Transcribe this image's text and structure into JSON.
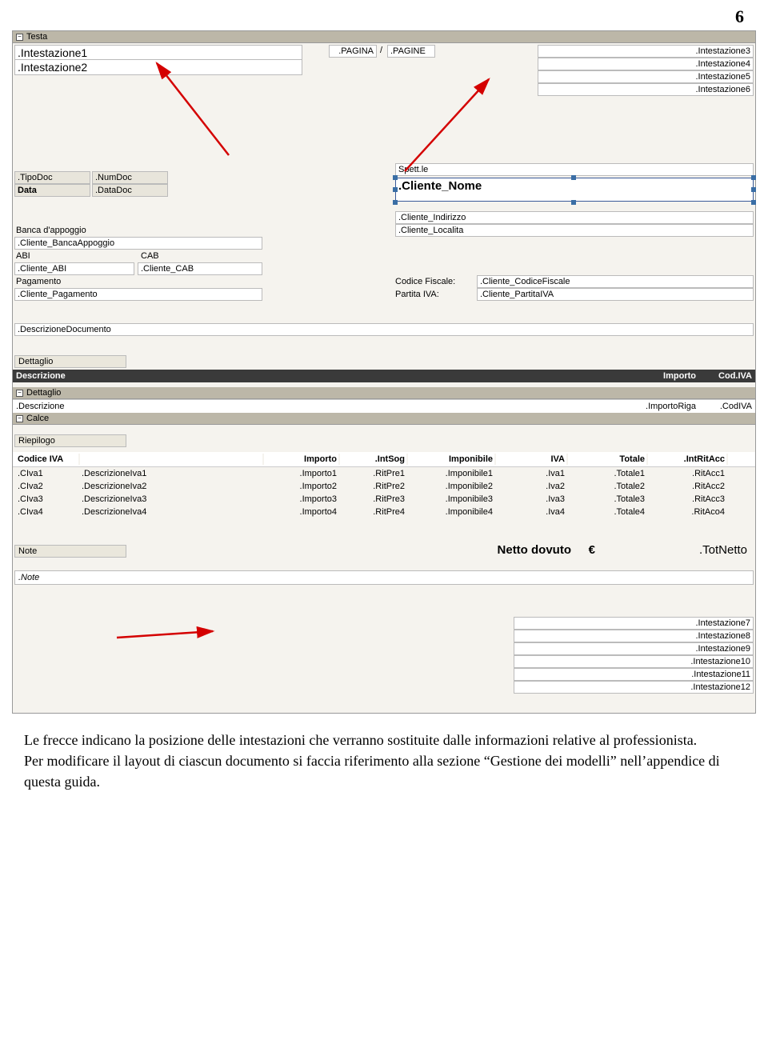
{
  "page_number": "6",
  "bands": {
    "testa": "Testa",
    "dettaglio": "Dettaglio",
    "calce": "Calce"
  },
  "header": {
    "int1": ".Intestazione1",
    "int2": ".Intestazione2",
    "pagina": ".PAGINA",
    "slash": "/",
    "pagine": ".PAGINE",
    "int3": ".Intestazione3",
    "int4": ".Intestazione4",
    "int5": ".Intestazione5",
    "int6": ".Intestazione6"
  },
  "doc": {
    "tipodoc_l": ".TipoDoc",
    "numdoc_l": ".NumDoc",
    "data_l": "Data",
    "datadoc_l": ".DataDoc"
  },
  "banca": {
    "banca_l": "Banca d'appoggio",
    "banca_f": ".Cliente_BancaAppoggio",
    "abi_l": "ABI",
    "cab_l": "CAB",
    "abi_f": ".Cliente_ABI",
    "cab_f": ".Cliente_CAB",
    "pag_l": "Pagamento",
    "pag_f": ".Cliente_Pagamento"
  },
  "cliente": {
    "spett": "Spett.le",
    "nome": ".Cliente_Nome",
    "indirizzo": ".Cliente_Indirizzo",
    "localita": ".Cliente_Localita",
    "cf_l": "Codice Fiscale:",
    "cf_f": ".Cliente_CodiceFiscale",
    "piva_l": "Partita IVA:",
    "piva_f": ".Cliente_PartitaIVA"
  },
  "descr_doc": ".DescrizioneDocumento",
  "dettaglio": {
    "label": "Dettaglio",
    "h_descr": "Descrizione",
    "h_importo": "Importo",
    "h_codiva": "Cod.IVA",
    "r_descr": ".Descrizione",
    "r_importo": ".ImportoRiga",
    "r_codiva": ".CodIVA"
  },
  "riepilogo": {
    "label": "Riepilogo",
    "h": [
      "Codice IVA",
      "",
      "Importo",
      ".IntSog",
      "Imponibile",
      "IVA",
      "Totale",
      ".IntRitAcc"
    ],
    "rows": [
      [
        ".CIva1",
        ".DescrizioneIva1",
        ".Importo1",
        ".RitPre1",
        ".Imponibile1",
        ".Iva1",
        ".Totale1",
        ".RitAcc1"
      ],
      [
        ".CIva2",
        ".DescrizioneIva2",
        ".Importo2",
        ".RitPre2",
        ".Imponibile2",
        ".Iva2",
        ".Totale2",
        ".RitAcc2"
      ],
      [
        ".CIva3",
        ".DescrizioneIva3",
        ".Importo3",
        ".RitPre3",
        ".Imponibile3",
        ".Iva3",
        ".Totale3",
        ".RitAcc3"
      ],
      [
        ".CIva4",
        ".DescrizioneIva4",
        ".Importo4",
        ".RitPre4",
        ".Imponibile4",
        ".Iva4",
        ".Totale4",
        ".RitAco4"
      ]
    ]
  },
  "netto": {
    "label": "Netto dovuto",
    "eur": "€",
    "val": ".TotNetto"
  },
  "note": {
    "label": "Note",
    "field": ".Note"
  },
  "footer_int": [
    ".Intestazione7",
    ".Intestazione8",
    ".Intestazione9",
    ".Intestazione10",
    ".Intestazione11",
    ".Intestazione12"
  ],
  "caption": "Le frecce indicano la posizione delle intestazioni che verranno sostituite dalle informazioni relative al professionista.\nPer modificare il layout di ciascun documento si faccia riferimento alla sezione “Gestione dei modelli” nell’appendice di questa guida."
}
